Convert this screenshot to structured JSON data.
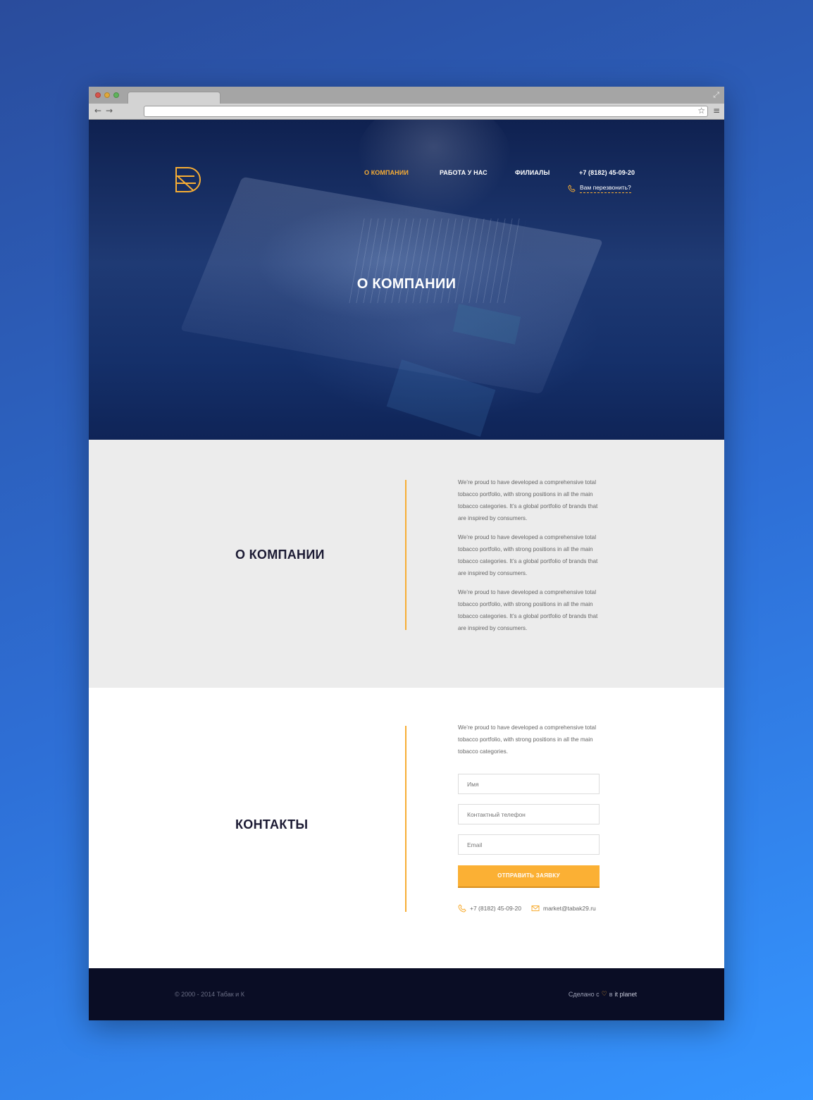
{
  "browser": {
    "url": "",
    "back_icon": "←",
    "forward_icon": "→",
    "star_icon": "☆",
    "menu_icon": "≡",
    "resize_icon": "⤢"
  },
  "header": {
    "nav": [
      "О КОМПАНИИ",
      "РАБОТА У НАС",
      "ФИЛИАЛЫ"
    ],
    "phone": "+7 (8182) 45-09-20",
    "callback": "Вам перезвонить?"
  },
  "hero": {
    "title": "О КОМПАНИИ"
  },
  "about": {
    "title": "О КОМПАНИИ",
    "paragraphs": [
      "We’re proud to have developed a comprehensive total tobacco portfolio, with strong positions in all the main tobacco categories. It’s a global portfolio of brands that are inspired by consumers.",
      "We’re proud to have developed a comprehensive total tobacco portfolio, with strong positions in all the main tobacco categories. It’s a global portfolio of brands that are inspired by consumers.",
      "We’re proud to have developed a comprehensive total tobacco portfolio, with strong positions in all the main tobacco categories. It’s a global portfolio of brands that are inspired by consumers."
    ]
  },
  "contacts": {
    "title": "КОНТАКТЫ",
    "intro": "We’re proud to have developed a comprehensive total tobacco portfolio, with strong positions in all the main tobacco categories.",
    "name_placeholder": "Имя",
    "phone_placeholder": "Контактный телефон",
    "email_placeholder": "Email",
    "submit_label": "ОТПРАВИТЬ ЗАЯВКУ",
    "phone": "+7 (8182) 45-09-20",
    "email": "market@tabak29.ru"
  },
  "footer": {
    "copyright": "© 2000 - 2014 Табак и К",
    "made_prefix": "Сделано с",
    "made_mid": "в",
    "made_brand": "it planet"
  },
  "colors": {
    "accent": "#f7ad34",
    "dark": "#1b1a33",
    "footer_bg": "#0a0d25"
  }
}
